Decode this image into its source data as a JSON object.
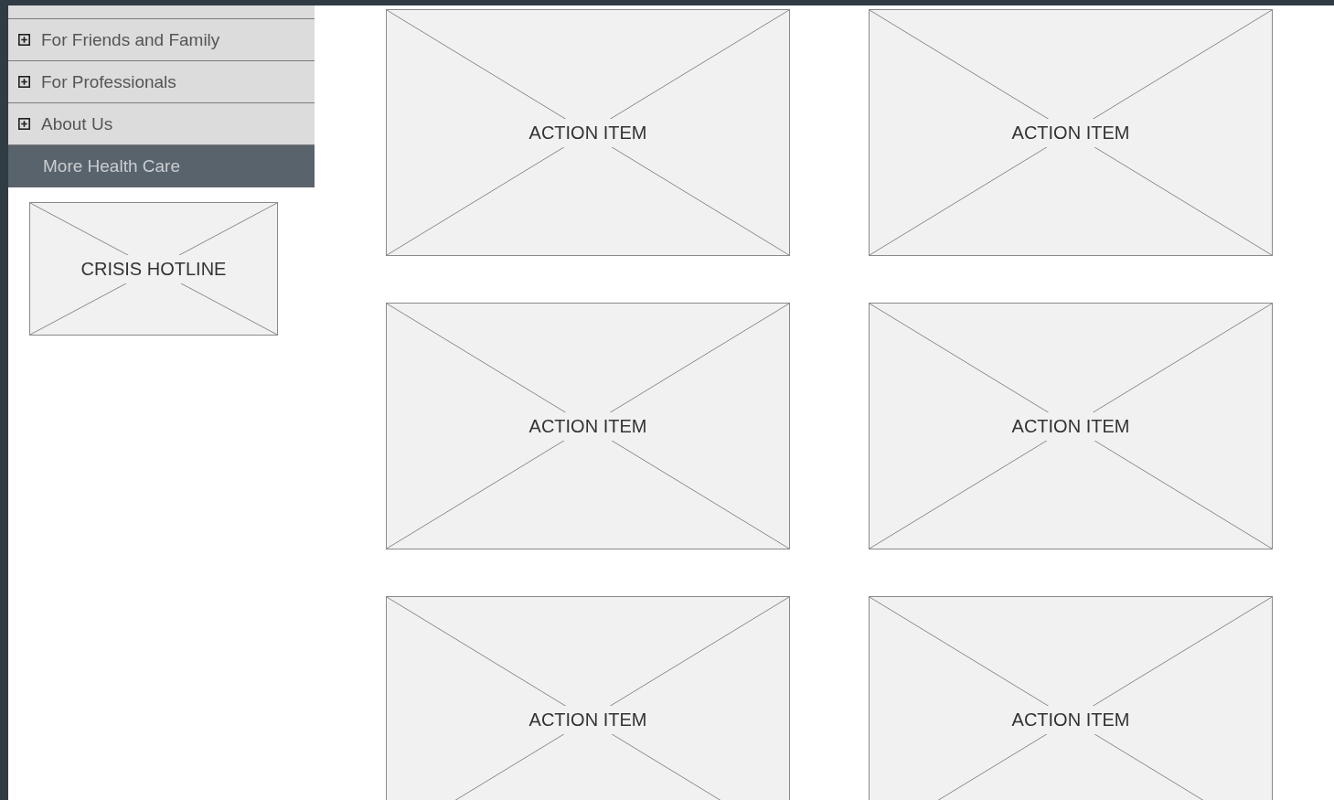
{
  "sidebar": {
    "menu": [
      {
        "label": "For Friends and Family",
        "kind": "expandable",
        "selected": false
      },
      {
        "label": "For Professionals",
        "kind": "expandable",
        "selected": false
      },
      {
        "label": "About Us",
        "kind": "expandable",
        "selected": false
      },
      {
        "label": "More Health Care",
        "kind": "link",
        "selected": true
      }
    ],
    "crisis": {
      "label": "CRISIS HOTLINE"
    }
  },
  "action_items": [
    {
      "label": "ACTION ITEM"
    },
    {
      "label": "ACTION ITEM"
    },
    {
      "label": "ACTION ITEM"
    },
    {
      "label": "ACTION ITEM"
    },
    {
      "label": "ACTION ITEM"
    },
    {
      "label": "ACTION ITEM"
    }
  ]
}
